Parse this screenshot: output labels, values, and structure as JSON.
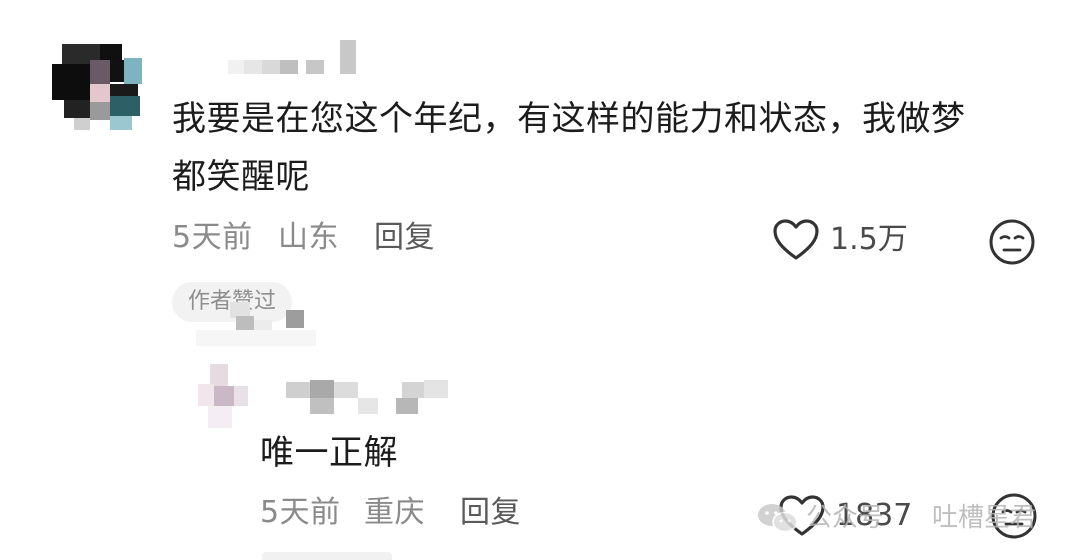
{
  "comment": {
    "text_line1": "我要是在您这个年纪，有这样的能力和状态，我做梦",
    "text_line2": "都笑醒呢",
    "time": "5天前",
    "location": "山东",
    "reply_label": "回复",
    "like_count": "1.5万",
    "author_liked_tag": "作者赞过"
  },
  "reply": {
    "text": "唯一正解",
    "time": "5天前",
    "location": "重庆",
    "reply_label": "回复",
    "like_count": "1837"
  },
  "watermark": {
    "text_left": "公众号",
    "text_right": "吐槽星君"
  },
  "icons": {
    "like": "heart-outline-icon",
    "dislike": "unamused-face-icon",
    "watermark": "wechat-icon"
  }
}
